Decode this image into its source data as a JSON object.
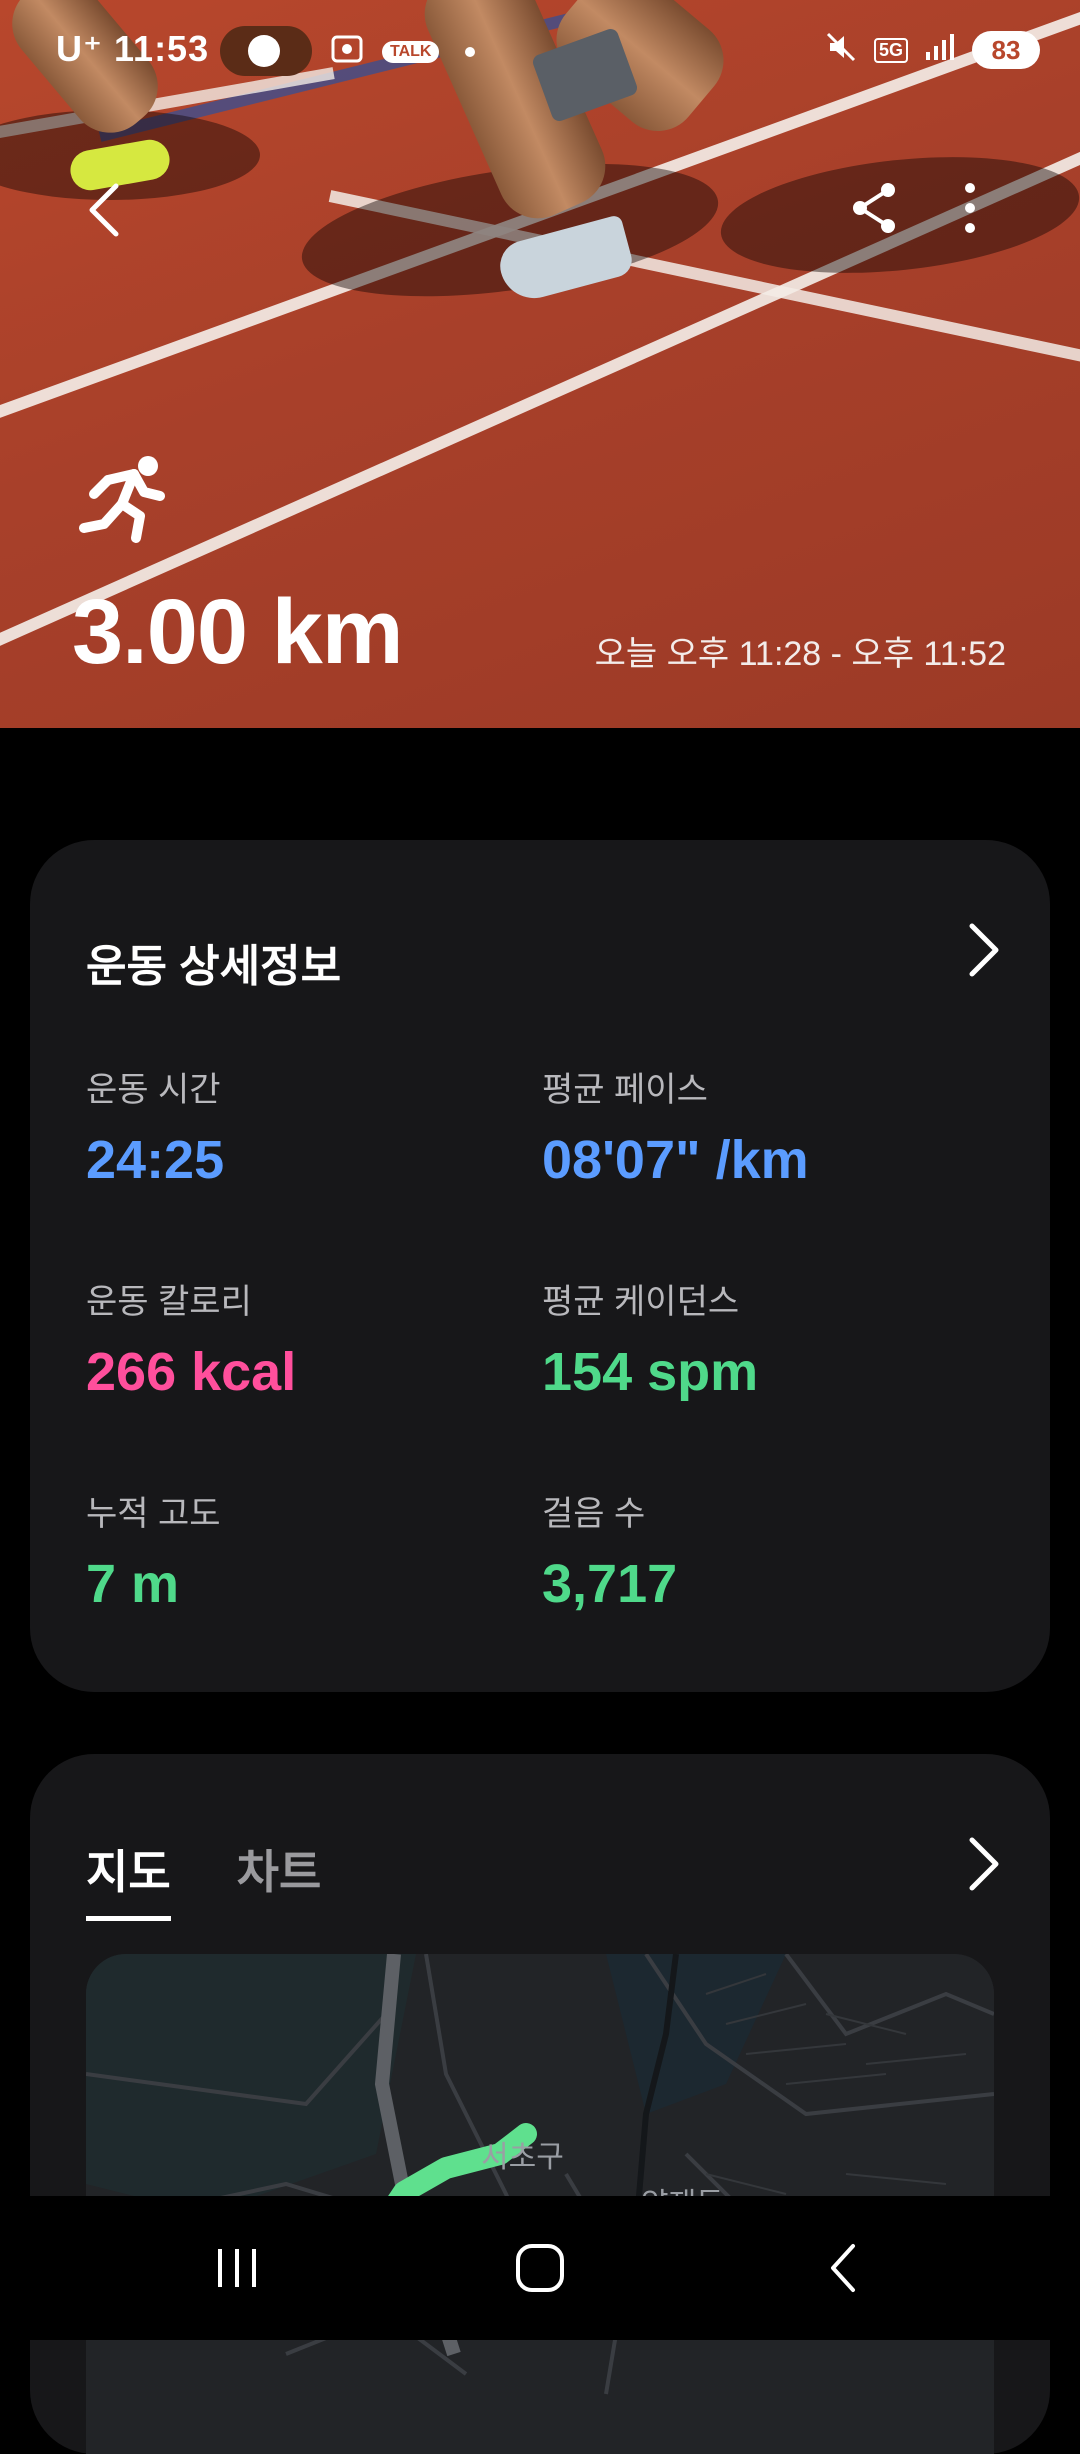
{
  "status_bar": {
    "carrier": "U⁺",
    "time": "11:53",
    "talk_badge": "TALK",
    "network": "5G",
    "battery": "83"
  },
  "hero": {
    "distance": "3.00 km",
    "time_range": "오늘 오후 11:28 - 오후 11:52"
  },
  "details_card": {
    "title": "운동 상세정보",
    "metrics": [
      {
        "label": "운동 시간",
        "value": "24:25"
      },
      {
        "label": "평균 페이스",
        "value": "08'07\" /km"
      },
      {
        "label": "운동 칼로리",
        "value": "266 kcal"
      },
      {
        "label": "평균 케이던스",
        "value": "154 spm"
      },
      {
        "label": "누적 고도",
        "value": "7 m"
      },
      {
        "label": "걸음 수",
        "value": "3,717"
      }
    ]
  },
  "map_card": {
    "tabs": [
      "지도",
      "차트"
    ],
    "map_labels": [
      "서초구",
      "양재동"
    ]
  },
  "colors": {
    "accent_blue": "#5b9cff",
    "accent_pink": "#ff4f9c",
    "accent_green": "#4fd98a",
    "route": "#5fe08e"
  }
}
